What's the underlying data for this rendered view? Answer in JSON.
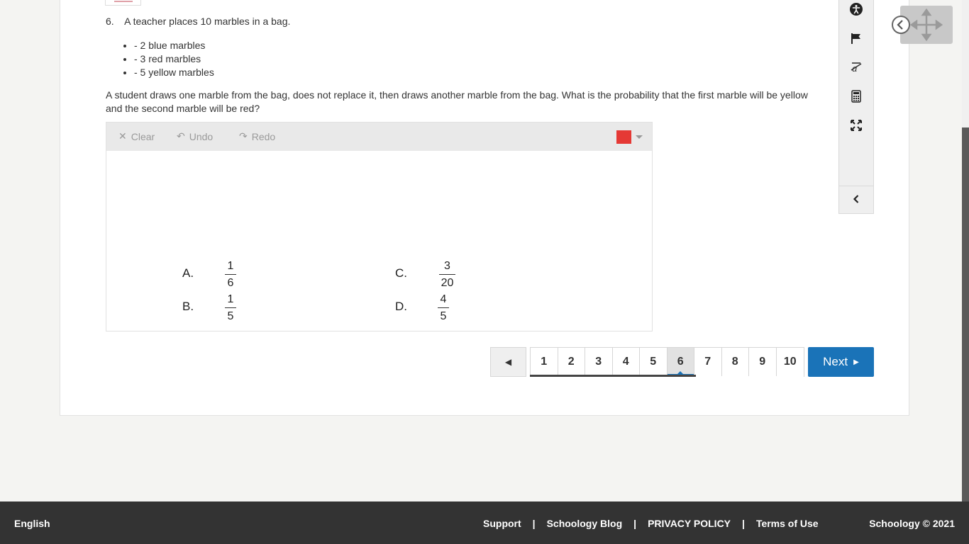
{
  "question": {
    "number": "6.",
    "intro": "A teacher places 10 marbles in a bag.",
    "bullets": [
      "- 2 blue marbles",
      "- 3 red marbles",
      "- 5 yellow marbles"
    ],
    "prompt": "A student draws one marble from the bag, does not replace it, then draws another marble from the bag.  What is the probability that the first marble will be yellow and the second marble will be red?"
  },
  "drawing_toolbar": {
    "clear_label": "Clear",
    "undo_label": "Undo",
    "redo_label": "Redo",
    "pen_color": "#e53935"
  },
  "choices": [
    {
      "letter": "A.",
      "num": "1",
      "den": "6"
    },
    {
      "letter": "B.",
      "num": "1",
      "den": "5"
    },
    {
      "letter": "C.",
      "num": "3",
      "den": "20"
    },
    {
      "letter": "D.",
      "num": "4",
      "den": "5"
    }
  ],
  "pagination": {
    "pages": [
      "1",
      "2",
      "3",
      "4",
      "5",
      "6",
      "7",
      "8",
      "9",
      "10"
    ],
    "current": "6",
    "next_label": "Next"
  },
  "tools": [
    "accessibility-icon",
    "flag-icon",
    "strikethrough-tool-icon",
    "calculator-icon",
    "fullscreen-icon",
    "collapse-left-icon"
  ],
  "footer": {
    "language": "English",
    "links": [
      "Support",
      "Schoology Blog",
      "PRIVACY POLICY",
      "Terms of Use"
    ],
    "separator": "|",
    "copyright": "Schoology © 2021"
  },
  "colors": {
    "accent": "#1a73b8",
    "footer_bg": "#333333",
    "page_bg": "#f4f4f2"
  }
}
